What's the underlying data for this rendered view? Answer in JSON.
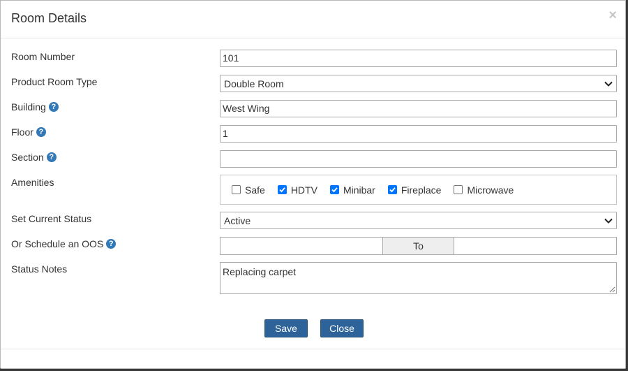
{
  "dialog": {
    "title": "Room Details",
    "close_glyph": "×"
  },
  "fields": {
    "room_number": {
      "label": "Room Number",
      "value": "101"
    },
    "product_room_type": {
      "label": "Product Room Type",
      "value": "Double Room"
    },
    "building": {
      "label": "Building",
      "value": "West Wing"
    },
    "floor": {
      "label": "Floor",
      "value": "1"
    },
    "section": {
      "label": "Section",
      "value": ""
    },
    "amenities": {
      "label": "Amenities",
      "items": [
        {
          "label": "Safe",
          "checked": false
        },
        {
          "label": "HDTV",
          "checked": true
        },
        {
          "label": "Minibar",
          "checked": true
        },
        {
          "label": "Fireplace",
          "checked": true
        },
        {
          "label": "Microwave",
          "checked": false
        }
      ]
    },
    "current_status": {
      "label": "Set Current Status",
      "value": "Active"
    },
    "schedule_oos": {
      "label": "Or Schedule an OOS",
      "from": "",
      "to_label": "To",
      "to": ""
    },
    "status_notes": {
      "label": "Status Notes",
      "value": "Replacing carpet"
    }
  },
  "help_glyph": "?",
  "buttons": {
    "save": "Save",
    "close": "Close"
  },
  "colors": {
    "primary_button": "#2d6398",
    "help_icon": "#3479b7",
    "checkbox_checked": "#0075ff"
  }
}
